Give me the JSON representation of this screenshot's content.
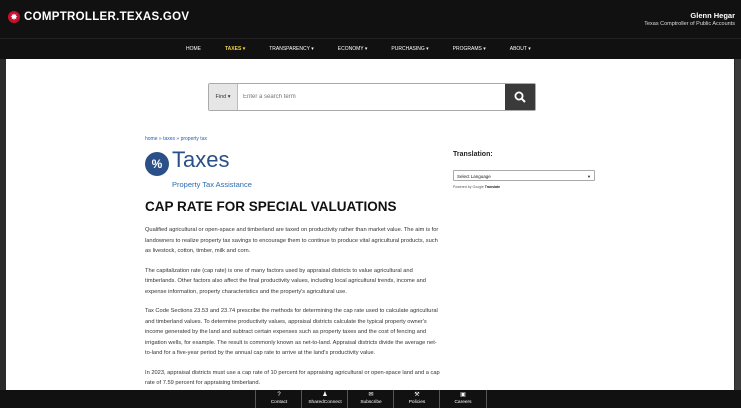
{
  "header": {
    "logo_text": "COMPTROLLER.TEXAS.GOV",
    "official_name": "Glenn Hegar",
    "official_title": "Texas Comptroller of Public Accounts"
  },
  "nav": {
    "items": [
      {
        "label": "HOME"
      },
      {
        "label": "TAXES ▾"
      },
      {
        "label": "TRANSPARENCY ▾"
      },
      {
        "label": "ECONOMY ▾"
      },
      {
        "label": "PURCHASING ▾"
      },
      {
        "label": "PROGRAMS ▾"
      },
      {
        "label": "ABOUT ▾"
      }
    ],
    "active_index": 1,
    "active_color": "#f5d142"
  },
  "search": {
    "find_label": "Find ▾",
    "placeholder": "Enter a search term",
    "icon": "search-icon"
  },
  "breadcrumb": "home » taxes » property tax",
  "section": {
    "badge": "%",
    "title": "Taxes",
    "subtitle": "Property Tax Assistance"
  },
  "page_title": "CAP RATE FOR SPECIAL VALUATIONS",
  "paragraphs": [
    "Qualified agricultural or open-space and timberland are taxed on productivity rather than market value. The aim is for landowners to realize property tax savings to encourage them to continue to produce vital agricultural products, such as livestock, cotton, timber, milk and corn.",
    "The capitalization rate (cap rate) is one of many factors used by appraisal districts to value agricultural and timberlands. Other factors also affect the final productivity values, including local agricultural trends, income and expense information, property characteristics and the property's agricultural use.",
    "Tax Code Sections 23.53 and 23.74 prescribe the methods for determining the cap rate used to calculate agricultural and timberland values. To determine productivity values, appraisal districts calculate the typical property owner's income generated by the land and subtract certain expenses such as property taxes and the cost of fencing and irrigation wells, for example. The result is commonly known as net-to-land. Appraisal districts divide the average net-to-land for a five-year period by the annual cap rate to arrive at the land's productivity value.",
    "In 2023, appraisal districts must use a cap rate of 10 percent for appraising agricultural or open-space land and a cap rate of 7.59 percent for appraising timberland."
  ],
  "translation": {
    "heading": "Translation:",
    "select_value": "Select Language",
    "powered_prefix": "Powered by",
    "powered_google": "Google",
    "powered_suffix": "Translate"
  },
  "footer": {
    "items": [
      {
        "icon": "question-icon",
        "glyph": "?",
        "label": "Contact"
      },
      {
        "icon": "user-icon",
        "glyph": "♟",
        "label": "SharedConnect"
      },
      {
        "icon": "envelope-icon",
        "glyph": "✉",
        "label": "Subscribe"
      },
      {
        "icon": "gavel-icon",
        "glyph": "⚒",
        "label": "Policies"
      },
      {
        "icon": "briefcase-icon",
        "glyph": "▣",
        "label": "Careers"
      }
    ]
  }
}
